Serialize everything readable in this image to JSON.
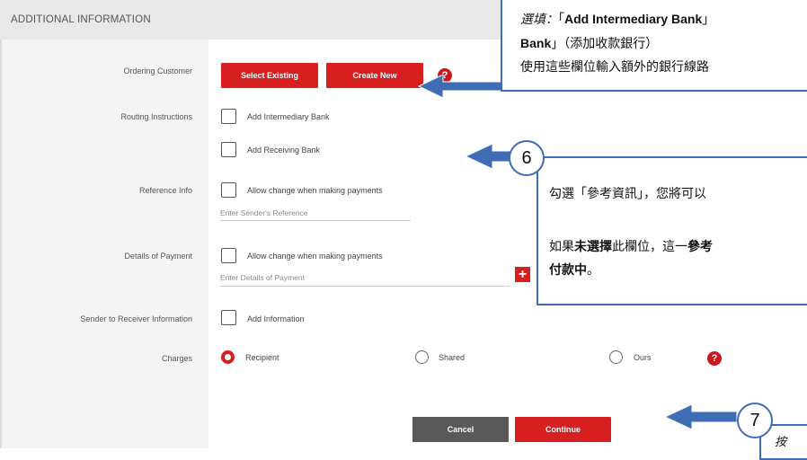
{
  "header": {
    "title": "ADDITIONAL INFORMATION"
  },
  "rows": {
    "ordering_customer": {
      "label": "Ordering Customer",
      "select_existing": "Select Existing",
      "create_new": "Create New"
    },
    "routing_instructions": {
      "label": "Routing Instructions",
      "intermediary": "Add Intermediary Bank",
      "receiving": "Add Receiving Bank"
    },
    "reference_info": {
      "label": "Reference Info",
      "allow_change": "Allow change when making payments",
      "placeholder": "Enter Sender's Reference"
    },
    "details_of_payment": {
      "label": "Details of Payment",
      "allow_change": "Allow change when making payments",
      "placeholder": "Enter Details of Payment"
    },
    "sender_to_receiver": {
      "label": "Sender to Receiver Information",
      "add_info": "Add Information"
    },
    "charges": {
      "label": "Charges",
      "options": [
        "Recipient",
        "Shared",
        "Ours"
      ],
      "selected": "Recipient"
    }
  },
  "actions": {
    "cancel": "Cancel",
    "continue": "Continue"
  },
  "callouts": {
    "top": {
      "line1_italic": "選填：",
      "line1_open": "「",
      "line1_bold": "Add Intermediary Bank",
      "line1_close": "」",
      "line2_bold": "Bank",
      "line2_rest": "」（添加收款銀行）",
      "line3": "使用這些欄位輸入額外的銀行線路"
    },
    "six": {
      "badge": "6",
      "line1": "勾選「參考資訊」，您將可以",
      "line2_a": "如果",
      "line2_bold1": "未選擇",
      "line2_b": "此欄位，這一",
      "line2_bold2": "參考",
      "line3_bold": "付款中",
      "line3_rest": "。"
    },
    "seven": {
      "badge": "7",
      "line1": "按"
    }
  },
  "colors": {
    "accent_red": "#d71f20",
    "callout_blue": "#3e6db5",
    "cancel_gray": "#595959"
  },
  "icons": {
    "help": "?",
    "plus": "+"
  }
}
